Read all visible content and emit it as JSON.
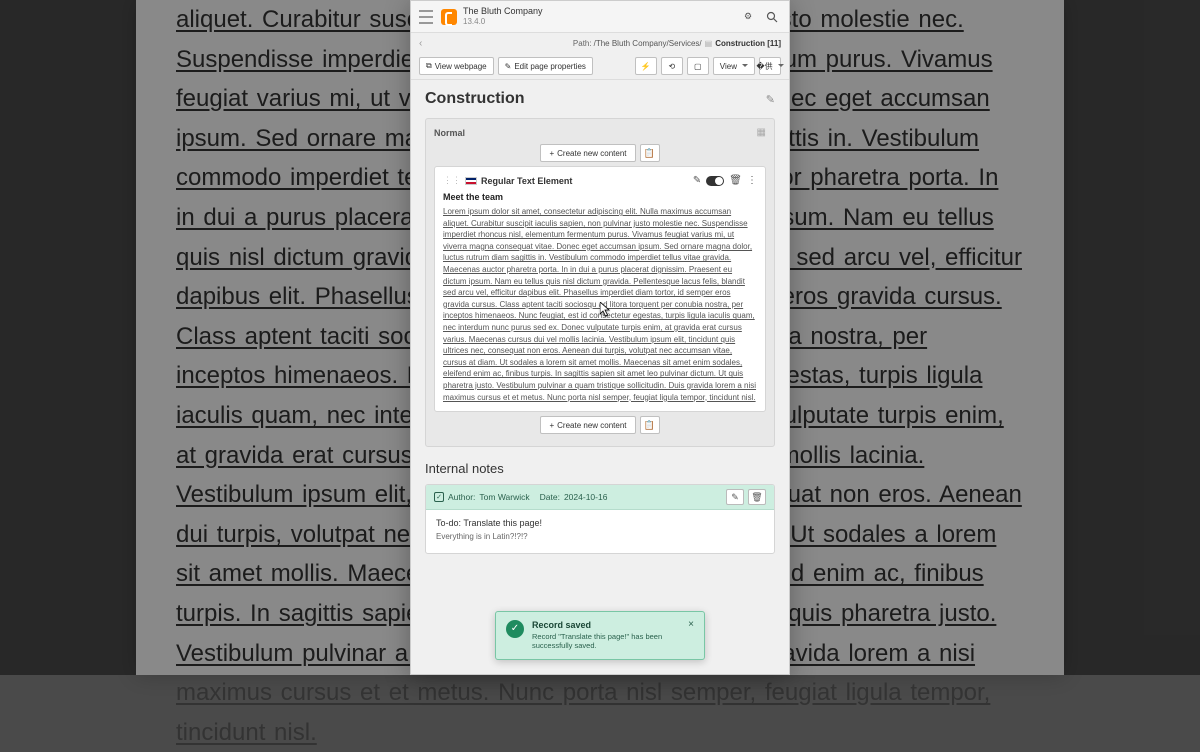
{
  "topbar": {
    "site_name": "The Bluth Company",
    "version": "13.4.0"
  },
  "breadcrumb": {
    "path_label": "Path:",
    "path": "/The Bluth Company/Services/",
    "current": "Construction [11]"
  },
  "actions": {
    "view_webpage": "View webpage",
    "edit_props": "Edit page properties",
    "view": "View"
  },
  "page": {
    "title": "Construction"
  },
  "zone": {
    "name": "Normal",
    "create": "Create new content",
    "element_type": "Regular Text Element",
    "element_heading": "Meet the team",
    "element_body": "Lorem ipsum dolor sit amet, consectetur adipiscing elit. Nulla maximus accumsan aliquet. Curabitur suscipit iaculis sapien, non pulvinar justo molestie nec. Suspendisse imperdiet rhoncus nisl, elementum fermentum purus. Vivamus feugiat varius mi, ut viverra magna consequat vitae. Donec eget accumsan ipsum. Sed ornare magna dolor, luctus rutrum diam sagittis in. Vestibulum commodo imperdiet tellus vitae gravida. Maecenas auctor pharetra porta. In in dui a purus placerat dignissim. Praesent eu dictum ipsum. Nam eu tellus quis nisl dictum gravida. Pellentesque lacus felis, blandit sed arcu vel, efficitur dapibus elit. Phasellus imperdiet diam tortor, id semper eros gravida cursus. Class aptent taciti sociosqu ad litora torquent per conubia nostra, per inceptos himenaeos. Nunc feugiat, est id consectetur egestas, turpis ligula iaculis quam, nec interdum nunc purus sed ex. Donec vulputate turpis enim, at gravida erat cursus varius. Maecenas cursus dui vel mollis lacinia. Vestibulum ipsum elit, tincidunt quis ultrices nec, consequat non eros. Aenean dui turpis, volutpat nec accumsan vitae, cursus at diam. Ut sodales a lorem sit amet mollis. Maecenas sit amet enim sodales, eleifend enim ac, finibus turpis. In sagittis sapien sit amet leo pulvinar dictum. Ut quis pharetra justo. Vestibulum pulvinar a quam tristique sollicitudin. Duis gravida lorem a nisi maximus cursus et et metus. Nunc porta nisl semper, feugiat ligula tempor, tincidunt nisl."
  },
  "notes": {
    "section": "Internal notes",
    "author_lbl": "Author:",
    "author": "Tom Warwick",
    "date_lbl": "Date:",
    "date": "2024-10-16",
    "todo": "To-do: Translate this page!",
    "sub": "Everything is in Latin?!?!?"
  },
  "toast": {
    "title": "Record saved",
    "msg": "Record \"Translate this page!\" has been successfully saved."
  },
  "bg_text": "aliquet. Curabitur suscipit iaculis sapien, non pulvinar justo molestie nec. Suspendisse imperdiet rhoncus nisl, elementum fermentum purus. Vivamus feugiat varius mi, ut viverra magna consequat vitae. Donec eget accumsan ipsum. Sed ornare magna dolor, luctus rutrum diam sagittis in. Vestibulum commodo imperdiet tellus vitae gravida. Maecenas auctor pharetra porta. In in dui a purus placerat dignissim. Praesent eu dictum ipsum. Nam eu tellus quis nisl dictum gravida. Pellentesque lacus felis, blandit sed arcu vel, efficitur dapibus elit. Phasellus imperdiet diam tortor, id semper eros gravida cursus. Class aptent taciti sociosqu ad litora torquent per conubia nostra, per inceptos himenaeos. Nunc feugiat, est id consectetur egestas, turpis ligula iaculis quam, nec interdum nunc purus sed ex. Donec vulputate turpis enim, at gravida erat cursus varius. Maecenas cursus dui vel mollis lacinia. Vestibulum ipsum elit, tincidunt quis ultrices nec, consequat non eros. Aenean dui turpis, volutpat nec accumsan vitae, cursus at diam. Ut sodales a lorem sit amet mollis. Maecenas sit amet enim sodales, eleifend enim ac, finibus turpis. In sagittis sapien sit amet leo pulvinar dictum. Ut quis pharetra justo. Vestibulum pulvinar a quam tristique sollicitudin. Duis gravida lorem a nisi maximus cursus et et metus. Nunc porta nisl semper, feugiat ligula tempor, tincidunt nisl."
}
